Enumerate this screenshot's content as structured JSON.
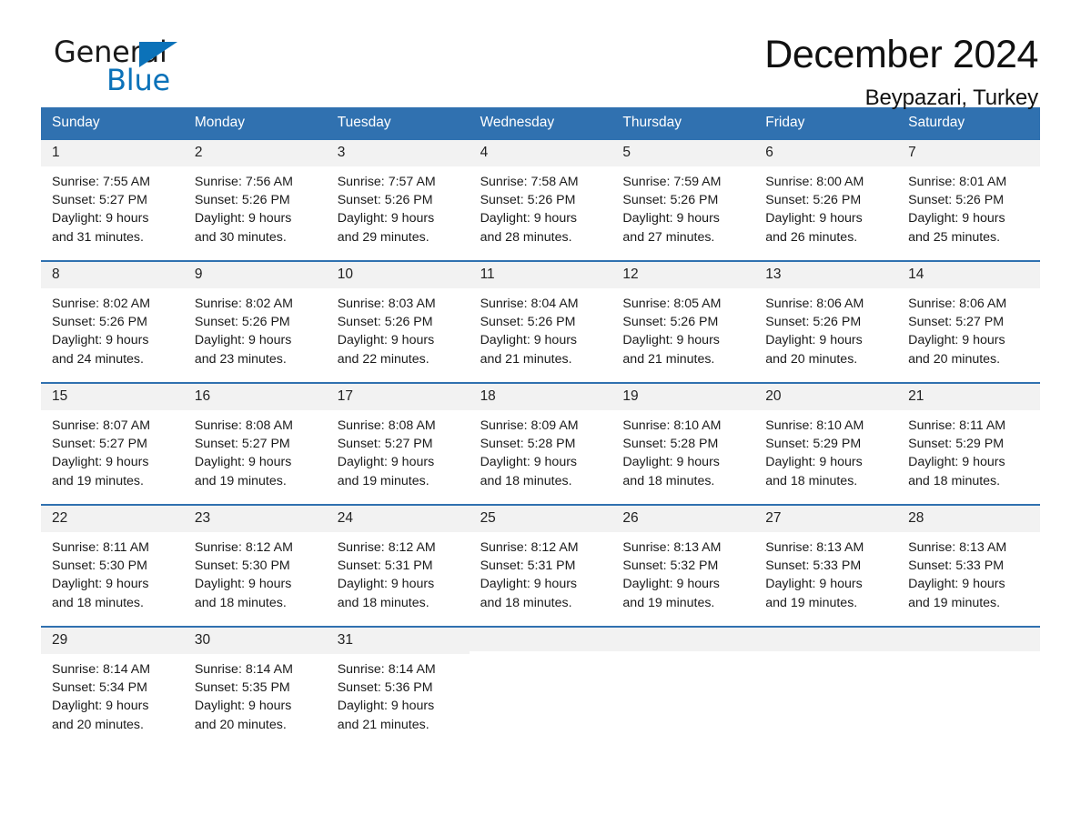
{
  "brand": {
    "name_dark": "General",
    "name_blue": "Blue",
    "accent_color": "#0b72b9"
  },
  "header": {
    "month_title": "December 2024",
    "location": "Beypazari, Turkey",
    "header_bg_color": "#3071b0",
    "day_band_color": "#f2f2f2"
  },
  "weekdays": [
    "Sunday",
    "Monday",
    "Tuesday",
    "Wednesday",
    "Thursday",
    "Friday",
    "Saturday"
  ],
  "weeks": [
    {
      "days": [
        {
          "date": "1",
          "sunrise": "Sunrise: 7:55 AM",
          "sunset": "Sunset: 5:27 PM",
          "daylight": "Daylight: 9 hours and 31 minutes.",
          "info": "Sunrise: 7:55 AM\nSunset: 5:27 PM\nDaylight: 9 hours\nand 31 minutes."
        },
        {
          "date": "2",
          "sunrise": "Sunrise: 7:56 AM",
          "sunset": "Sunset: 5:26 PM",
          "daylight": "Daylight: 9 hours and 30 minutes.",
          "info": "Sunrise: 7:56 AM\nSunset: 5:26 PM\nDaylight: 9 hours\nand 30 minutes."
        },
        {
          "date": "3",
          "sunrise": "Sunrise: 7:57 AM",
          "sunset": "Sunset: 5:26 PM",
          "daylight": "Daylight: 9 hours and 29 minutes.",
          "info": "Sunrise: 7:57 AM\nSunset: 5:26 PM\nDaylight: 9 hours\nand 29 minutes."
        },
        {
          "date": "4",
          "sunrise": "Sunrise: 7:58 AM",
          "sunset": "Sunset: 5:26 PM",
          "daylight": "Daylight: 9 hours and 28 minutes.",
          "info": "Sunrise: 7:58 AM\nSunset: 5:26 PM\nDaylight: 9 hours\nand 28 minutes."
        },
        {
          "date": "5",
          "sunrise": "Sunrise: 7:59 AM",
          "sunset": "Sunset: 5:26 PM",
          "daylight": "Daylight: 9 hours and 27 minutes.",
          "info": "Sunrise: 7:59 AM\nSunset: 5:26 PM\nDaylight: 9 hours\nand 27 minutes."
        },
        {
          "date": "6",
          "sunrise": "Sunrise: 8:00 AM",
          "sunset": "Sunset: 5:26 PM",
          "daylight": "Daylight: 9 hours and 26 minutes.",
          "info": "Sunrise: 8:00 AM\nSunset: 5:26 PM\nDaylight: 9 hours\nand 26 minutes."
        },
        {
          "date": "7",
          "sunrise": "Sunrise: 8:01 AM",
          "sunset": "Sunset: 5:26 PM",
          "daylight": "Daylight: 9 hours and 25 minutes.",
          "info": "Sunrise: 8:01 AM\nSunset: 5:26 PM\nDaylight: 9 hours\nand 25 minutes."
        }
      ]
    },
    {
      "days": [
        {
          "date": "8",
          "sunrise": "Sunrise: 8:02 AM",
          "sunset": "Sunset: 5:26 PM",
          "daylight": "Daylight: 9 hours and 24 minutes.",
          "info": "Sunrise: 8:02 AM\nSunset: 5:26 PM\nDaylight: 9 hours\nand 24 minutes."
        },
        {
          "date": "9",
          "sunrise": "Sunrise: 8:02 AM",
          "sunset": "Sunset: 5:26 PM",
          "daylight": "Daylight: 9 hours and 23 minutes.",
          "info": "Sunrise: 8:02 AM\nSunset: 5:26 PM\nDaylight: 9 hours\nand 23 minutes."
        },
        {
          "date": "10",
          "sunrise": "Sunrise: 8:03 AM",
          "sunset": "Sunset: 5:26 PM",
          "daylight": "Daylight: 9 hours and 22 minutes.",
          "info": "Sunrise: 8:03 AM\nSunset: 5:26 PM\nDaylight: 9 hours\nand 22 minutes."
        },
        {
          "date": "11",
          "sunrise": "Sunrise: 8:04 AM",
          "sunset": "Sunset: 5:26 PM",
          "daylight": "Daylight: 9 hours and 21 minutes.",
          "info": "Sunrise: 8:04 AM\nSunset: 5:26 PM\nDaylight: 9 hours\nand 21 minutes."
        },
        {
          "date": "12",
          "sunrise": "Sunrise: 8:05 AM",
          "sunset": "Sunset: 5:26 PM",
          "daylight": "Daylight: 9 hours and 21 minutes.",
          "info": "Sunrise: 8:05 AM\nSunset: 5:26 PM\nDaylight: 9 hours\nand 21 minutes."
        },
        {
          "date": "13",
          "sunrise": "Sunrise: 8:06 AM",
          "sunset": "Sunset: 5:26 PM",
          "daylight": "Daylight: 9 hours and 20 minutes.",
          "info": "Sunrise: 8:06 AM\nSunset: 5:26 PM\nDaylight: 9 hours\nand 20 minutes."
        },
        {
          "date": "14",
          "sunrise": "Sunrise: 8:06 AM",
          "sunset": "Sunset: 5:27 PM",
          "daylight": "Daylight: 9 hours and 20 minutes.",
          "info": "Sunrise: 8:06 AM\nSunset: 5:27 PM\nDaylight: 9 hours\nand 20 minutes."
        }
      ]
    },
    {
      "days": [
        {
          "date": "15",
          "sunrise": "Sunrise: 8:07 AM",
          "sunset": "Sunset: 5:27 PM",
          "daylight": "Daylight: 9 hours and 19 minutes.",
          "info": "Sunrise: 8:07 AM\nSunset: 5:27 PM\nDaylight: 9 hours\nand 19 minutes."
        },
        {
          "date": "16",
          "sunrise": "Sunrise: 8:08 AM",
          "sunset": "Sunset: 5:27 PM",
          "daylight": "Daylight: 9 hours and 19 minutes.",
          "info": "Sunrise: 8:08 AM\nSunset: 5:27 PM\nDaylight: 9 hours\nand 19 minutes."
        },
        {
          "date": "17",
          "sunrise": "Sunrise: 8:08 AM",
          "sunset": "Sunset: 5:27 PM",
          "daylight": "Daylight: 9 hours and 19 minutes.",
          "info": "Sunrise: 8:08 AM\nSunset: 5:27 PM\nDaylight: 9 hours\nand 19 minutes."
        },
        {
          "date": "18",
          "sunrise": "Sunrise: 8:09 AM",
          "sunset": "Sunset: 5:28 PM",
          "daylight": "Daylight: 9 hours and 18 minutes.",
          "info": "Sunrise: 8:09 AM\nSunset: 5:28 PM\nDaylight: 9 hours\nand 18 minutes."
        },
        {
          "date": "19",
          "sunrise": "Sunrise: 8:10 AM",
          "sunset": "Sunset: 5:28 PM",
          "daylight": "Daylight: 9 hours and 18 minutes.",
          "info": "Sunrise: 8:10 AM\nSunset: 5:28 PM\nDaylight: 9 hours\nand 18 minutes."
        },
        {
          "date": "20",
          "sunrise": "Sunrise: 8:10 AM",
          "sunset": "Sunset: 5:29 PM",
          "daylight": "Daylight: 9 hours and 18 minutes.",
          "info": "Sunrise: 8:10 AM\nSunset: 5:29 PM\nDaylight: 9 hours\nand 18 minutes."
        },
        {
          "date": "21",
          "sunrise": "Sunrise: 8:11 AM",
          "sunset": "Sunset: 5:29 PM",
          "daylight": "Daylight: 9 hours and 18 minutes.",
          "info": "Sunrise: 8:11 AM\nSunset: 5:29 PM\nDaylight: 9 hours\nand 18 minutes."
        }
      ]
    },
    {
      "days": [
        {
          "date": "22",
          "sunrise": "Sunrise: 8:11 AM",
          "sunset": "Sunset: 5:30 PM",
          "daylight": "Daylight: 9 hours and 18 minutes.",
          "info": "Sunrise: 8:11 AM\nSunset: 5:30 PM\nDaylight: 9 hours\nand 18 minutes."
        },
        {
          "date": "23",
          "sunrise": "Sunrise: 8:12 AM",
          "sunset": "Sunset: 5:30 PM",
          "daylight": "Daylight: 9 hours and 18 minutes.",
          "info": "Sunrise: 8:12 AM\nSunset: 5:30 PM\nDaylight: 9 hours\nand 18 minutes."
        },
        {
          "date": "24",
          "sunrise": "Sunrise: 8:12 AM",
          "sunset": "Sunset: 5:31 PM",
          "daylight": "Daylight: 9 hours and 18 minutes.",
          "info": "Sunrise: 8:12 AM\nSunset: 5:31 PM\nDaylight: 9 hours\nand 18 minutes."
        },
        {
          "date": "25",
          "sunrise": "Sunrise: 8:12 AM",
          "sunset": "Sunset: 5:31 PM",
          "daylight": "Daylight: 9 hours and 18 minutes.",
          "info": "Sunrise: 8:12 AM\nSunset: 5:31 PM\nDaylight: 9 hours\nand 18 minutes."
        },
        {
          "date": "26",
          "sunrise": "Sunrise: 8:13 AM",
          "sunset": "Sunset: 5:32 PM",
          "daylight": "Daylight: 9 hours and 19 minutes.",
          "info": "Sunrise: 8:13 AM\nSunset: 5:32 PM\nDaylight: 9 hours\nand 19 minutes."
        },
        {
          "date": "27",
          "sunrise": "Sunrise: 8:13 AM",
          "sunset": "Sunset: 5:33 PM",
          "daylight": "Daylight: 9 hours and 19 minutes.",
          "info": "Sunrise: 8:13 AM\nSunset: 5:33 PM\nDaylight: 9 hours\nand 19 minutes."
        },
        {
          "date": "28",
          "sunrise": "Sunrise: 8:13 AM",
          "sunset": "Sunset: 5:33 PM",
          "daylight": "Daylight: 9 hours and 19 minutes.",
          "info": "Sunrise: 8:13 AM\nSunset: 5:33 PM\nDaylight: 9 hours\nand 19 minutes."
        }
      ]
    },
    {
      "days": [
        {
          "date": "29",
          "sunrise": "Sunrise: 8:14 AM",
          "sunset": "Sunset: 5:34 PM",
          "daylight": "Daylight: 9 hours and 20 minutes.",
          "info": "Sunrise: 8:14 AM\nSunset: 5:34 PM\nDaylight: 9 hours\nand 20 minutes."
        },
        {
          "date": "30",
          "sunrise": "Sunrise: 8:14 AM",
          "sunset": "Sunset: 5:35 PM",
          "daylight": "Daylight: 9 hours and 20 minutes.",
          "info": "Sunrise: 8:14 AM\nSunset: 5:35 PM\nDaylight: 9 hours\nand 20 minutes."
        },
        {
          "date": "31",
          "sunrise": "Sunrise: 8:14 AM",
          "sunset": "Sunset: 5:36 PM",
          "daylight": "Daylight: 9 hours and 21 minutes.",
          "info": "Sunrise: 8:14 AM\nSunset: 5:36 PM\nDaylight: 9 hours\nand 21 minutes."
        },
        {
          "date": "",
          "sunrise": "",
          "sunset": "",
          "daylight": "",
          "info": ""
        },
        {
          "date": "",
          "sunrise": "",
          "sunset": "",
          "daylight": "",
          "info": ""
        },
        {
          "date": "",
          "sunrise": "",
          "sunset": "",
          "daylight": "",
          "info": ""
        },
        {
          "date": "",
          "sunrise": "",
          "sunset": "",
          "daylight": "",
          "info": ""
        }
      ]
    }
  ]
}
